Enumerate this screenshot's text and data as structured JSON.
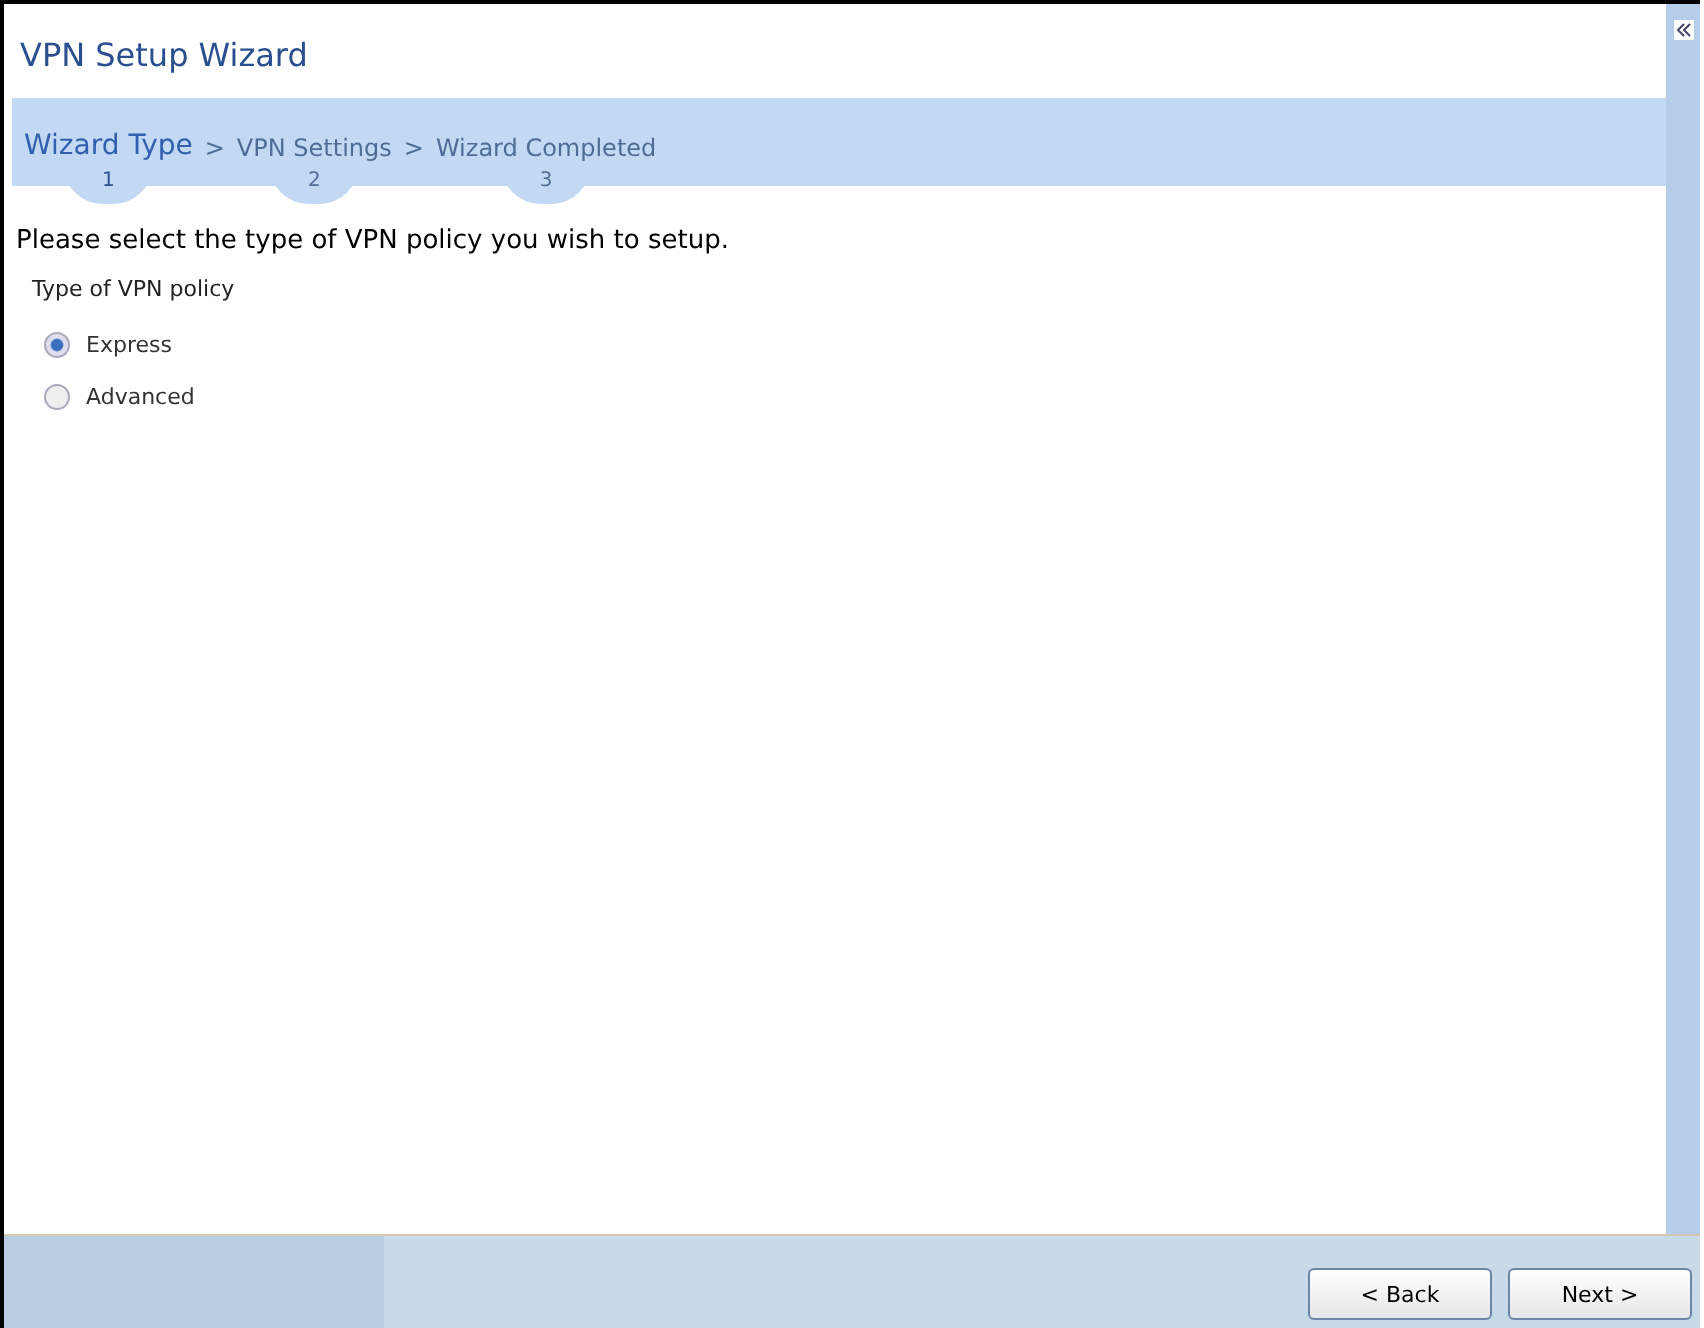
{
  "window": {
    "title": "VPN Setup Wizard"
  },
  "steps": [
    {
      "label": "Wizard Type",
      "number": "1",
      "selected": true
    },
    {
      "label": "VPN Settings",
      "number": "2",
      "selected": false
    },
    {
      "label": "Wizard Completed",
      "number": "3",
      "selected": false
    }
  ],
  "separator": ">",
  "prompt": "Please select the type of VPN policy you wish to setup.",
  "group_label": "Type of VPN policy",
  "options": [
    {
      "label": "Express",
      "selected": true
    },
    {
      "label": "Advanced",
      "selected": false
    }
  ],
  "buttons": [
    "< Back",
    "Next >"
  ]
}
